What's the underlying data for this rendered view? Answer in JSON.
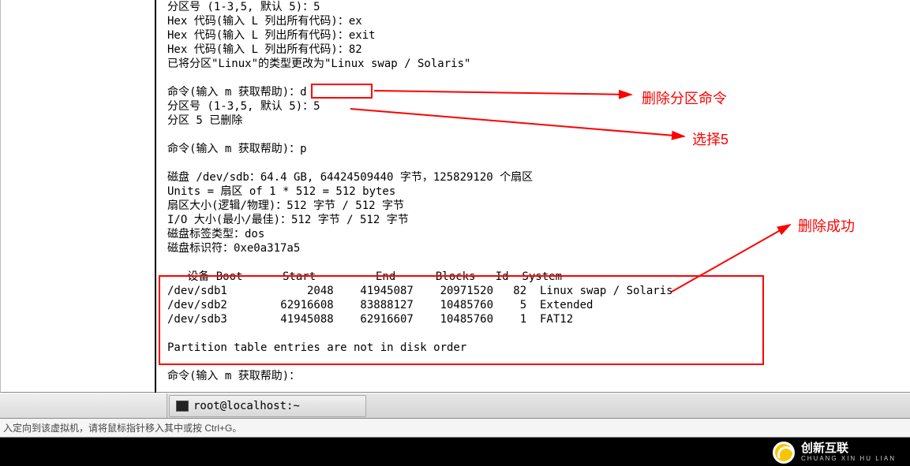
{
  "terminal": {
    "lines": [
      "分区号 (1-3,5, 默认 5)：5",
      "Hex 代码(输入 L 列出所有代码)：ex",
      "Hex 代码(输入 L 列出所有代码)：exit",
      "Hex 代码(输入 L 列出所有代码)：82",
      "已将分区\"Linux\"的类型更改为\"Linux swap / Solaris\"",
      "",
      "命令(输入 m 获取帮助)：d",
      "分区号 (1-3,5, 默认 5)：5",
      "分区 5 已删除",
      "",
      "命令(输入 m 获取帮助)：p",
      "",
      "磁盘 /dev/sdb：64.4 GB, 64424509440 字节，125829120 个扇区",
      "Units = 扇区 of 1 * 512 = 512 bytes",
      "扇区大小(逻辑/物理)：512 字节 / 512 字节",
      "I/O 大小(最小/最佳)：512 字节 / 512 字节",
      "磁盘标签类型：dos",
      "磁盘标识符：0xe0a317a5",
      "",
      "   设备 Boot      Start         End      Blocks   Id  System",
      "/dev/sdb1            2048    41945087    20971520   82  Linux swap / Solaris",
      "/dev/sdb2        62916608    83888127    10485760    5  Extended",
      "/dev/sdb3        41945088    62916607    10485760    1  FAT12",
      "",
      "Partition table entries are not in disk order",
      "",
      "命令(输入 m 获取帮助)："
    ]
  },
  "annotations": {
    "a1": "删除分区命令",
    "a2": "选择5",
    "a3": "删除成功"
  },
  "taskbar": {
    "item1": "root@localhost:~"
  },
  "hint": "入定向到该虚拟机，请将鼠标指针移入其中或按 Ctrl+G。",
  "brand": {
    "main": "创新互联",
    "sub": "CHUANG XIN HU LIAN"
  }
}
